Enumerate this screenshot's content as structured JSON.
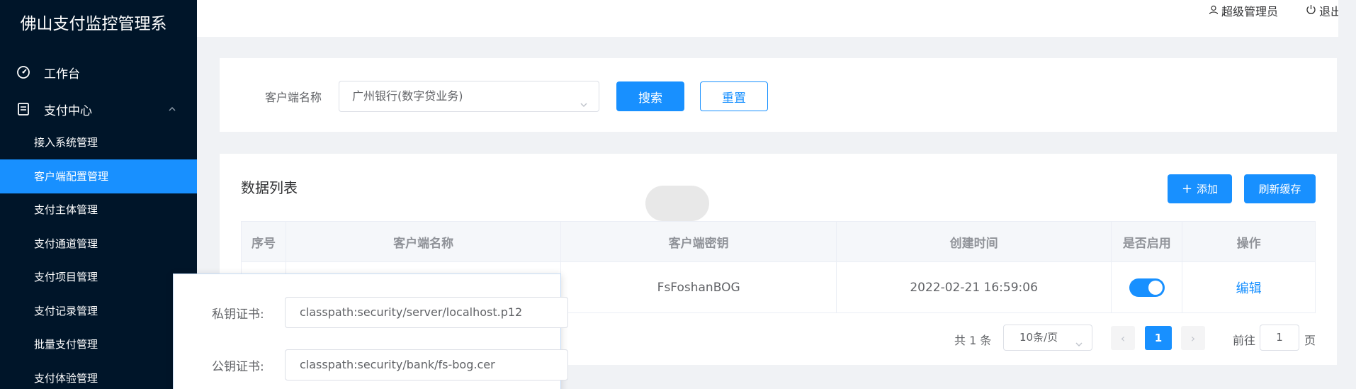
{
  "app": {
    "title": "佛山支付监控管理系"
  },
  "sidebar": {
    "items": [
      {
        "label": "工作台",
        "icon": "dashboard-icon"
      },
      {
        "label": "支付中心",
        "icon": "document-icon"
      }
    ],
    "sub_items": [
      {
        "label": "接入系统管理"
      },
      {
        "label": "客户端配置管理",
        "active": true
      },
      {
        "label": "支付主体管理"
      },
      {
        "label": "支付通道管理"
      },
      {
        "label": "支付项目管理"
      },
      {
        "label": "支付记录管理"
      },
      {
        "label": "批量支付管理"
      },
      {
        "label": "支付体验管理"
      }
    ]
  },
  "header": {
    "user": "超级管理员",
    "logout": "退出"
  },
  "search": {
    "label": "客户端名称",
    "selected": "广州银行(数字贷业务)",
    "search_button": "搜索",
    "reset_button": "重置"
  },
  "data_list": {
    "title": "数据列表",
    "add_button": "添加",
    "refresh_button": "刷新缓存",
    "columns": [
      "序号",
      "客户端名称",
      "客户端密钥",
      "创建时间",
      "是否启用",
      "操作"
    ],
    "rows": [
      {
        "index": "",
        "name": "",
        "key": "FsFoshanBOG",
        "created": "2022-02-21 16:59:06",
        "enabled": true,
        "action": "编辑"
      }
    ]
  },
  "pagination": {
    "total": "共 1 条",
    "page_size": "10条/页",
    "current": "1",
    "goto_label": "前往",
    "goto_value": "1",
    "page_suffix": "页"
  },
  "dialog": {
    "private_cert_label": "私钥证书:",
    "private_cert_value": "classpath:security/server/localhost.p12",
    "public_cert_label": "公钥证书:",
    "public_cert_value": "classpath:security/bank/fs-bog.cer"
  },
  "colors": {
    "primary": "#1890ff",
    "sidebar_bg": "#001529",
    "page_bg": "#f0f2f5"
  }
}
